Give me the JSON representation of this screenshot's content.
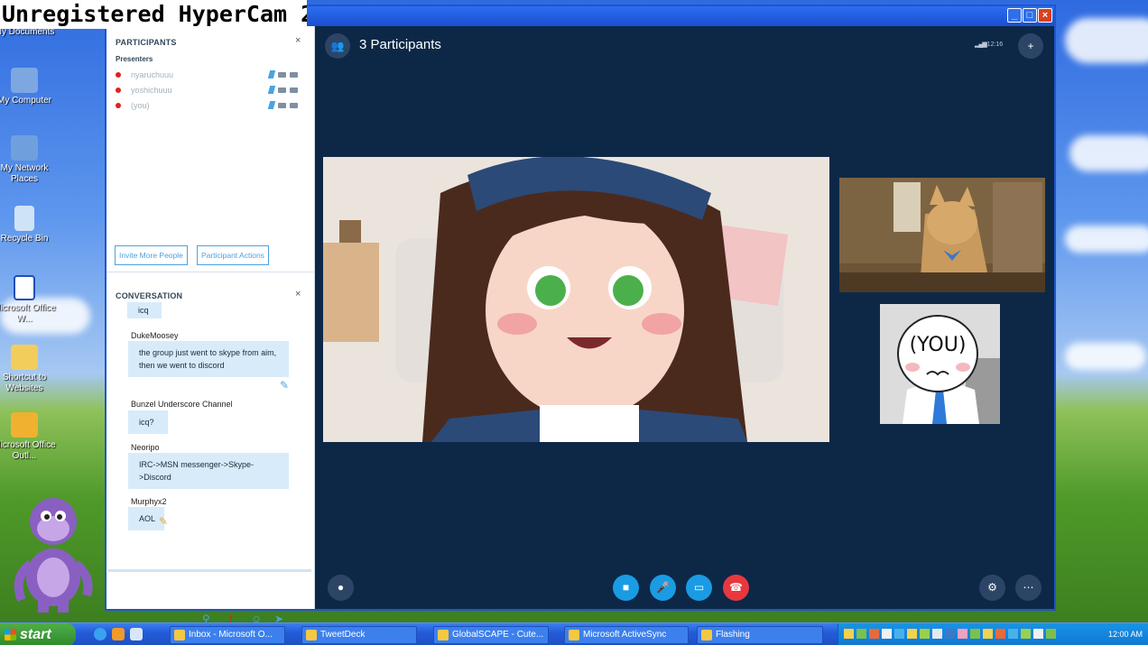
{
  "watermark": "Unregistered HyperCam 2",
  "desktop_icons": [
    {
      "label": "My Documents"
    },
    {
      "label": "My Computer"
    },
    {
      "label": "My Network Places"
    },
    {
      "label": "Recycle Bin"
    },
    {
      "label": "Microsoft Office W..."
    },
    {
      "label": "Shortcut to Websites"
    },
    {
      "label": "Microsoft Office Outl..."
    }
  ],
  "participants_panel": {
    "title": "PARTICIPANTS",
    "section": "Presenters",
    "people": [
      {
        "name": "nyaruchuuu"
      },
      {
        "name": "yoshichuuu"
      },
      {
        "name": "(you)"
      }
    ],
    "invite_label": "Invite More People",
    "actions_label": "Participant Actions"
  },
  "conversation": {
    "title": "CONVERSATION",
    "messages": [
      {
        "author": "",
        "text": "icq"
      },
      {
        "author": "DukeMoosey",
        "text": "the group just went to skype from aim, then we went to discord"
      },
      {
        "author": "Bunzel Underscore Channel",
        "text": "icq?"
      },
      {
        "author": "Neoripo",
        "text": "IRC->MSN messenger->Skype->Discord"
      },
      {
        "author": "Murphyx2",
        "text": "AOL"
      }
    ]
  },
  "call": {
    "title": "3 Participants",
    "time": "12:16",
    "self_label": "(YOU)"
  },
  "taskbar": {
    "start_label": "start",
    "buttons": [
      {
        "label": "Inbox - Microsoft O..."
      },
      {
        "label": "TweetDeck"
      },
      {
        "label": "GlobalSCAPE - Cute..."
      },
      {
        "label": "Microsoft ActiveSync"
      },
      {
        "label": "Flashing"
      }
    ],
    "clock": "12:00 AM"
  }
}
